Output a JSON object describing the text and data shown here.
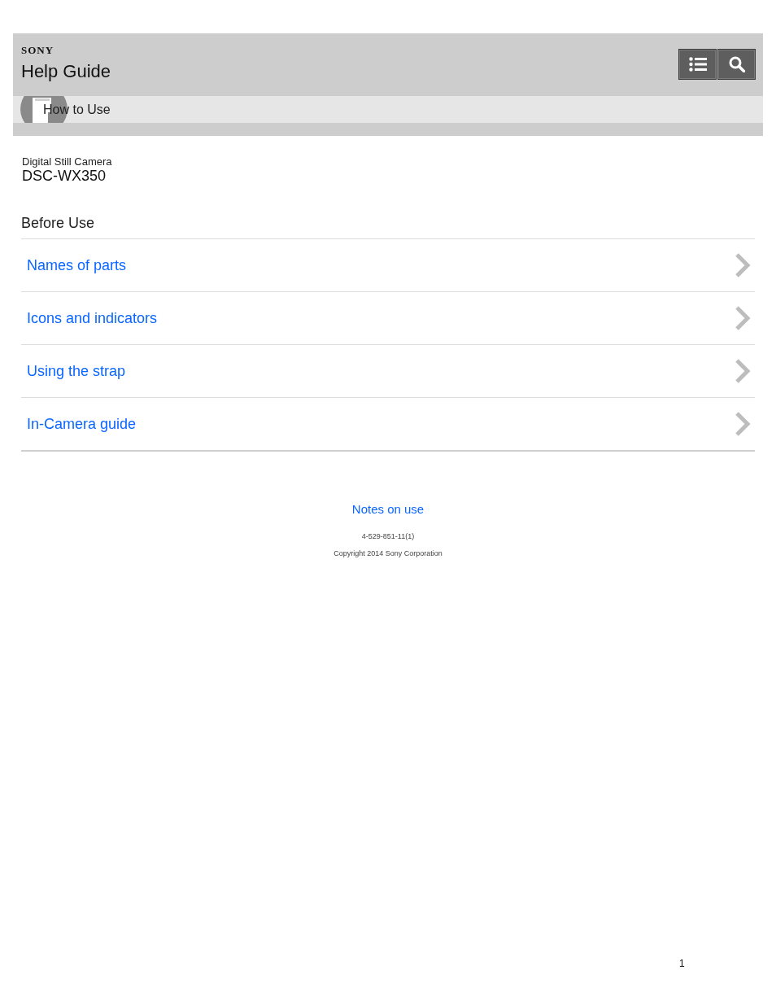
{
  "header": {
    "logo": "SONY",
    "title": "Help Guide"
  },
  "breadcrumb": {
    "label": "How to Use"
  },
  "product": {
    "category": "Digital Still Camera",
    "model": "DSC-WX350"
  },
  "section": {
    "title": "Before Use",
    "items": [
      "Names of parts",
      "Icons and indicators",
      "Using the strap",
      "In-Camera guide"
    ]
  },
  "footer": {
    "link": "Notes on use",
    "code": "4-529-851-11(1)",
    "copyright": "Copyright 2014 Sony Corporation"
  },
  "page_number": "1"
}
